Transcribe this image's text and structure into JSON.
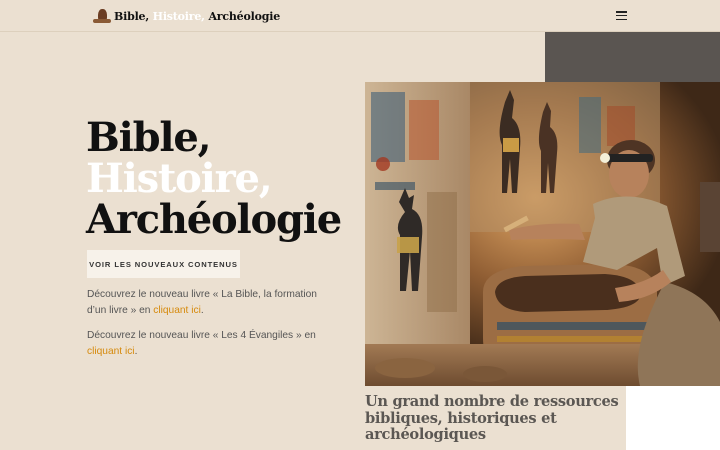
{
  "header": {
    "logo": {
      "icon": "amphora-logo-icon",
      "part1": "Bible,",
      "part2": "Histoire,",
      "part3": "Archéologie"
    },
    "menu_icon": "hamburger-menu-icon"
  },
  "hero": {
    "title_lines": [
      "Bible,",
      "Histoire,",
      "Archéologie"
    ],
    "cta_label": "VOIR LES NOUVEAUX CONTENUS",
    "paragraph1": {
      "text": "Découvrez le nouveau livre « La Bible, la formation d’un livre » en ",
      "link": "cliquant ici",
      "after": "."
    },
    "paragraph2": {
      "text": "Découvrez le nouveau livre « Les 4 Évangiles » en ",
      "link": "cliquant ici",
      "after": "."
    }
  },
  "photo": {
    "subject": "archaeologist-brushing-sarcophagus-in-egyptian-tomb"
  },
  "resources": {
    "heading": "Un grand nombre de ressources bibliques, historiques et archéologiques"
  },
  "colors": {
    "background": "#ebe0d1",
    "accent_link": "#d68a0c",
    "dark_block": "#5a5551",
    "button_bg": "#f7f2ea"
  }
}
